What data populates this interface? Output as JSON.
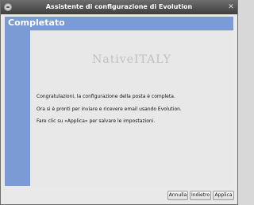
{
  "window": {
    "title": "Assistente di configurazione di Evolution"
  },
  "page": {
    "heading": "Completato",
    "watermark": "NativeITALY",
    "messages": [
      "Congratulazioni, la configurazione della posta è completa.",
      "Ora si è pronti per inviare e ricevere email usando Evolution.",
      "Fare clic su «Applica» per salvare le impostazioni."
    ]
  },
  "buttons": {
    "cancel": "Annulla",
    "back": "Indietro",
    "apply": "Applica"
  },
  "icons": {
    "app": "evolution-app-icon",
    "close": "close-icon"
  },
  "colors": {
    "accent": "#7b9bd4"
  }
}
